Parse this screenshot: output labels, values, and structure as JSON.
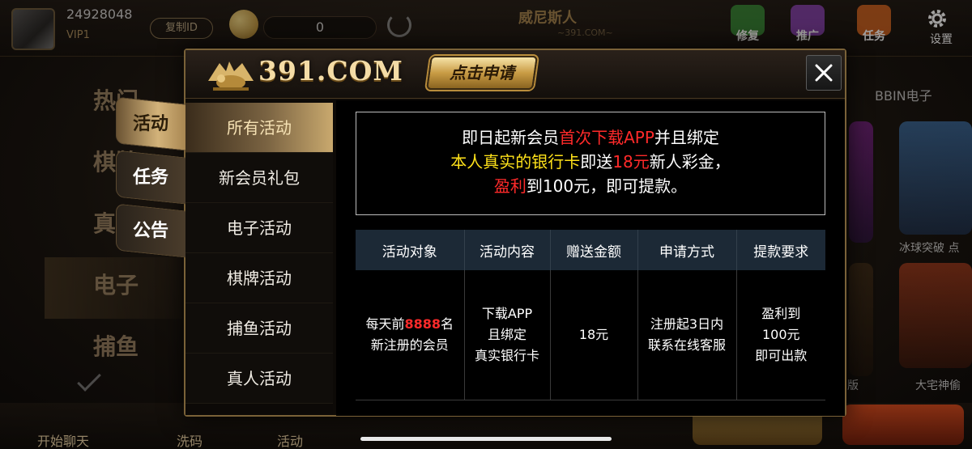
{
  "user": {
    "id": "24928048",
    "level": "VIP1",
    "copy_label": "复制ID",
    "balance": "0"
  },
  "brand": {
    "background_name": "威尼斯人",
    "background_sub": "~391.COM~",
    "modal_logo": "391.COM"
  },
  "top_icons": [
    {
      "label": "修复",
      "icon": "repair-icon",
      "color": "#2f7d2f"
    },
    {
      "label": "推广",
      "icon": "promote-icon",
      "color": "#7a3aa0"
    },
    {
      "label": "任务",
      "icon": "task-icon",
      "color": "#c25a1a"
    }
  ],
  "settings_label": "设置",
  "bg_left_nav": [
    "热门",
    "棋牌",
    "真人",
    "电子",
    "捕鱼"
  ],
  "bg_right": {
    "label": "BBIN电子",
    "captions": [
      "冰球突破 点",
      "版",
      "大宅神偷"
    ]
  },
  "bottom_bar": {
    "items": [
      "开始聊天",
      "洗码",
      "活动"
    ]
  },
  "modal": {
    "apply_label": "点击申请",
    "side_tabs": [
      "活动",
      "任务",
      "公告"
    ],
    "categories": [
      "所有活动",
      "新会员礼包",
      "电子活动",
      "棋牌活动",
      "捕鱼活动",
      "真人活动"
    ],
    "notice": {
      "line1_a": "即日起新会员",
      "line1_b": "首次",
      "line1_c": "下载APP",
      "line1_d": "并且绑定",
      "line2_a": "本人真实的银行卡",
      "line2_b": "即送",
      "line2_c": "18元",
      "line2_d": "新人彩金，",
      "line3_a": "盈利",
      "line3_b": "到100元，即可提款。"
    },
    "table": {
      "headers": [
        "活动对象",
        "活动内容",
        "赠送金额",
        "申请方式",
        "提款要求"
      ],
      "row": {
        "target_a": "每天前",
        "target_num": "8888",
        "target_b": "名",
        "target_c": "新注册的会员",
        "content_1": "下载APP",
        "content_2": "且绑定",
        "content_3": "真实银行卡",
        "amount": "18元",
        "apply_1": "注册起3日内",
        "apply_2": "联系在线客服",
        "withdraw_1": "盈利到",
        "withdraw_2": "100元",
        "withdraw_3": "即可出款"
      }
    }
  }
}
